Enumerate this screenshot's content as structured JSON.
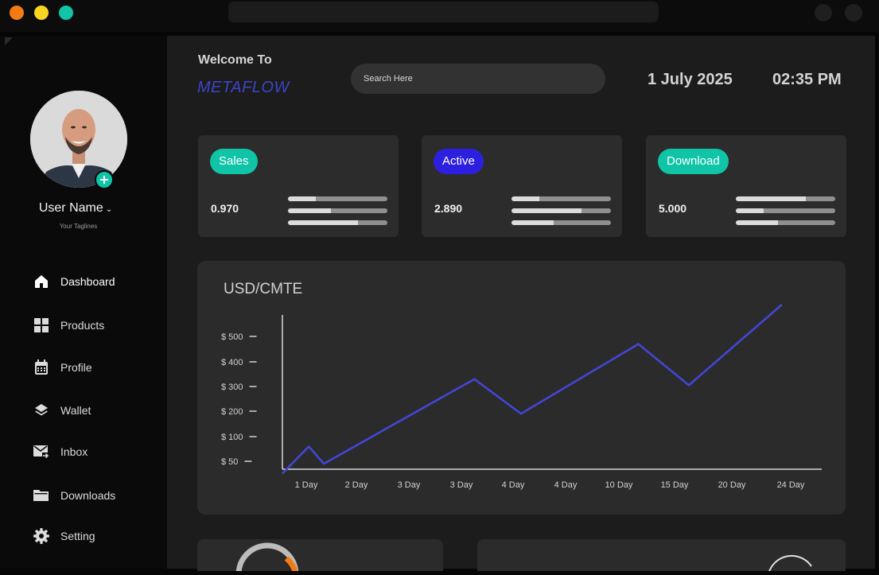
{
  "window": {
    "controls": [
      {
        "name": "close",
        "color": "#f37b14"
      },
      {
        "name": "minimize",
        "color": "#f8d520"
      },
      {
        "name": "maximize",
        "color": "#10c4a8"
      }
    ]
  },
  "sidebar": {
    "user": {
      "name": "User Name",
      "tagline": "Your Taglines",
      "avatar_icon": "user-photo",
      "add_badge_icon": "plus-icon"
    },
    "items": [
      {
        "label": "Dashboard",
        "icon": "home-icon",
        "active": true
      },
      {
        "label": "Products",
        "icon": "grid-icon",
        "active": false
      },
      {
        "label": "Profile",
        "icon": "calendar-icon",
        "active": false
      },
      {
        "label": "Wallet",
        "icon": "layers-icon",
        "active": false
      },
      {
        "label": "Inbox",
        "icon": "mail-icon",
        "active": false
      },
      {
        "label": "Downloads",
        "icon": "folder-icon",
        "active": false
      },
      {
        "label": "Setting",
        "icon": "gear-icon",
        "active": false
      }
    ]
  },
  "header": {
    "welcome": "Welcome To",
    "brand": "METAFLOW",
    "search_placeholder": "Search Here",
    "date": "1 July 2025",
    "time": "02:35 PM"
  },
  "stats": [
    {
      "label": "Sales",
      "value": "0.970",
      "color": "#10c4a8",
      "bars": [
        0.28,
        0.43,
        0.7
      ]
    },
    {
      "label": "Active",
      "value": "2.890",
      "color": "#2d1fe0",
      "bars": [
        0.28,
        0.7,
        0.42
      ]
    },
    {
      "label": "Download",
      "value": "5.000",
      "color": "#10c4a8",
      "bars": [
        0.7,
        0.28,
        0.42
      ]
    }
  ],
  "chart_data": {
    "type": "line",
    "title": "USD/CMTE",
    "xlabel": "",
    "ylabel": "",
    "categories": [
      "1 Day",
      "2 Day",
      "3 Day",
      "3 Day",
      "4 Day",
      "4 Day",
      "10 Day",
      "15 Day",
      "20 Day",
      "24 Day"
    ],
    "y_ticks": [
      {
        "label": "$ 50",
        "value": 50
      },
      {
        "label": "$ 100",
        "value": 100
      },
      {
        "label": "$ 200",
        "value": 200
      },
      {
        "label": "$ 300",
        "value": 300
      },
      {
        "label": "$ 400",
        "value": 400
      },
      {
        "label": "$ 500",
        "value": 500
      }
    ],
    "series": [
      {
        "color": "#4147d5",
        "points": [
          {
            "x": 0.0,
            "y": 25
          },
          {
            "x": 0.5,
            "y": 80
          },
          {
            "x": 0.8,
            "y": 45
          },
          {
            "x": 3.7,
            "y": 330
          },
          {
            "x": 4.6,
            "y": 190
          },
          {
            "x": 6.8,
            "y": 470
          },
          {
            "x": 7.7,
            "y": 305
          },
          {
            "x": 9.3,
            "y": 625
          }
        ]
      }
    ],
    "grid": false,
    "legend": "none"
  }
}
